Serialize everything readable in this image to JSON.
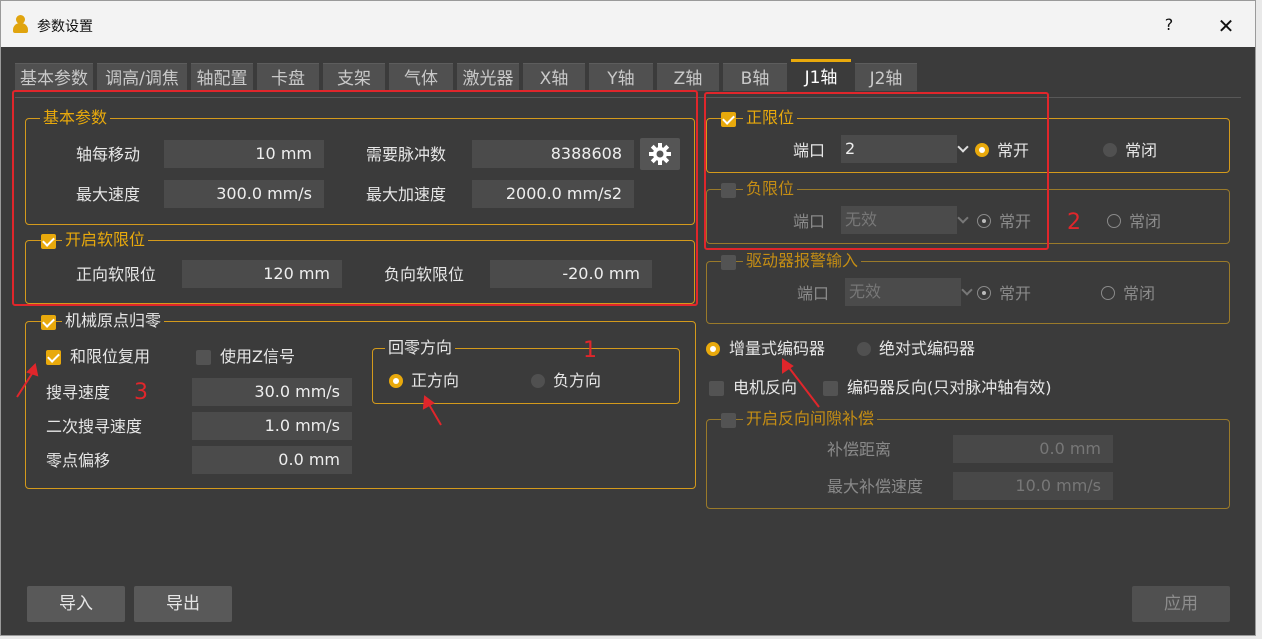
{
  "window": {
    "title": "参数设置",
    "help": "?",
    "close": "✕"
  },
  "tabs": [
    "基本参数",
    "调高/调焦",
    "轴配置",
    "卡盘",
    "支架",
    "气体",
    "激光器",
    "X轴",
    "Y轴",
    "Z轴",
    "B轴",
    "J1轴",
    "J2轴"
  ],
  "basic": {
    "legend": "基本参数",
    "move_label": "轴每移动",
    "move_value": "10 mm",
    "pulse_label": "需要脉冲数",
    "pulse_value": "8388608",
    "speed_label": "最大速度",
    "speed_value": "300.0 mm/s",
    "accel_label": "最大加速度",
    "accel_value": "2000.0 mm/s2"
  },
  "soft": {
    "legend": "开启软限位",
    "pos_label": "正向软限位",
    "pos_value": "120 mm",
    "neg_label": "负向软限位",
    "neg_value": "-20.0 mm"
  },
  "homing": {
    "legend": "机械原点归零",
    "reuse_label": "和限位复用",
    "zsignal_label": "使用Z信号",
    "search_label": "搜寻速度",
    "search_value": "30.0 mm/s",
    "search2_label": "二次搜寻速度",
    "search2_value": "1.0 mm/s",
    "offset_label": "零点偏移",
    "offset_value": "0.0 mm",
    "dir_legend": "回零方向",
    "dir_pos": "正方向",
    "dir_neg": "负方向"
  },
  "poslimit": {
    "legend": "正限位",
    "port_label": "端口",
    "port_value": "2",
    "no": "常开",
    "nc": "常闭"
  },
  "neglimit": {
    "legend": "负限位",
    "port_label": "端口",
    "port_value": "无效",
    "no": "常开",
    "nc": "常闭"
  },
  "alarm": {
    "legend": "驱动器报警输入",
    "port_label": "端口",
    "port_value": "无效",
    "no": "常开",
    "nc": "常闭"
  },
  "encoder": {
    "incremental": "增量式编码器",
    "absolute": "绝对式编码器",
    "motor_rev": "电机反向",
    "enc_rev": "编码器反向(只对脉冲轴有效)"
  },
  "backlash": {
    "legend": "开启反向间隙补偿",
    "dist_label": "补偿距离",
    "dist_value": "0.0 mm",
    "speed_label": "最大补偿速度",
    "speed_value": "10.0 mm/s"
  },
  "buttons": {
    "import": "导入",
    "export": "导出",
    "apply": "应用"
  },
  "annotations": [
    "1",
    "2",
    "3"
  ],
  "colors": {
    "accent": "#e8a90c",
    "annotation": "#e0262b",
    "background": "#3b3b3b"
  }
}
